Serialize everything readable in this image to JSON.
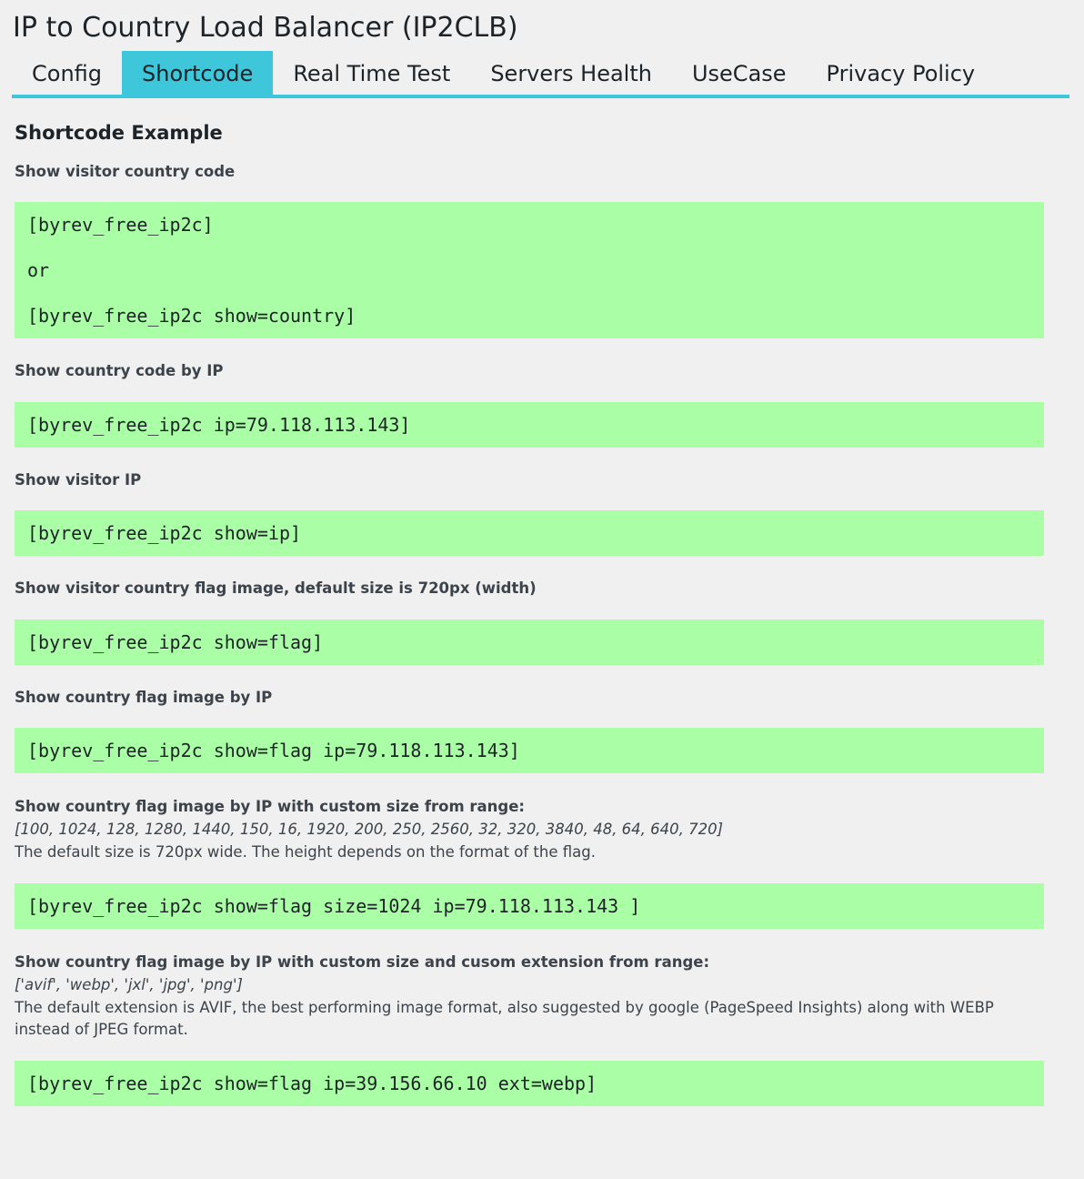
{
  "page": {
    "title": "IP to Country Load Balancer (IP2CLB)"
  },
  "tabs": [
    {
      "label": "Config",
      "active": false
    },
    {
      "label": "Shortcode",
      "active": true
    },
    {
      "label": "Real Time Test",
      "active": false
    },
    {
      "label": "Servers Health",
      "active": false
    },
    {
      "label": "UseCase",
      "active": false
    },
    {
      "label": "Privacy Policy",
      "active": false
    }
  ],
  "colors": {
    "accent": "#3ec6da",
    "code_background": "#aaffa6",
    "page_background": "#f0f0f0"
  },
  "main": {
    "section_title": "Shortcode Example",
    "examples": [
      {
        "label": "Show visitor country code",
        "code": [
          "[byrev_free_ip2c]",
          "or",
          "[byrev_free_ip2c show=country]"
        ]
      },
      {
        "label": "Show country code by IP",
        "code": [
          "[byrev_free_ip2c ip=79.118.113.143]"
        ]
      },
      {
        "label": "Show visitor IP",
        "code": [
          "[byrev_free_ip2c show=ip]"
        ]
      },
      {
        "label": "Show visitor country flag image, default size is 720px (width)",
        "code": [
          "[byrev_free_ip2c show=flag]"
        ]
      },
      {
        "label": "Show country flag image by IP",
        "code": [
          "[byrev_free_ip2c show=flag ip=79.118.113.143]"
        ]
      },
      {
        "label": "Show country flag image by IP with custom size from range:",
        "range": "[100, 1024, 128, 1280, 1440, 150, 16, 1920, 200, 250, 2560, 32, 320, 3840, 48, 64, 640, 720]",
        "note": "The default size is 720px wide. The height depends on the format of the flag.",
        "code": [
          "[byrev_free_ip2c show=flag size=1024 ip=79.118.113.143 ]"
        ]
      },
      {
        "label": "Show country flag image by IP with custom size and cusom extension from range:",
        "range": "['avif', 'webp', 'jxl', 'jpg', 'png']",
        "note": "The default extension is AVIF, the best performing image format, also suggested by google (PageSpeed Insights) along with WEBP instead of JPEG format.",
        "code": [
          "[byrev_free_ip2c show=flag ip=39.156.66.10 ext=webp]"
        ]
      }
    ]
  }
}
